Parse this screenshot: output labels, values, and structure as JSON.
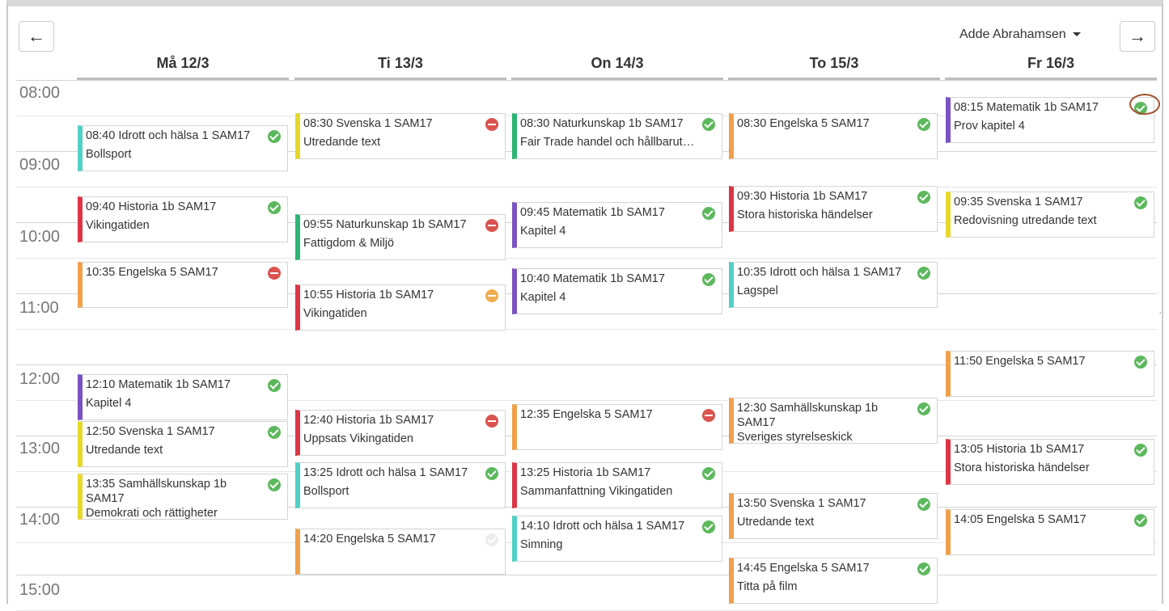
{
  "user": {
    "name": "Adde Abrahamsen"
  },
  "nav": {
    "prev_icon": "arrow-left",
    "next_icon": "arrow-right"
  },
  "days": [
    "Må 12/3",
    "Ti 13/3",
    "On 14/3",
    "To 15/3",
    "Fr 16/3"
  ],
  "times": [
    "08:00",
    "09:00",
    "10:00",
    "11:00",
    "12:00",
    "13:00",
    "14:00",
    "15:00"
  ],
  "colors": {
    "teal": "#4fd1c5",
    "red": "#dc3545",
    "orange": "#f0a04b",
    "purple": "#7b52c1",
    "yellow": "#e6d829",
    "green": "#2bb673",
    "status_ok": "#5cb85c",
    "status_no": "#d9534f",
    "status_warn": "#f0ad4e"
  },
  "events": {
    "mon": [
      {
        "line1": "08:40 Idrott och hälsa 1 SAM17",
        "line2": "Bollsport",
        "status": "ok"
      },
      {
        "line1": "09:40 Historia 1b SAM17",
        "line2": "Vikingatiden",
        "status": "ok"
      },
      {
        "line1": "10:35 Engelska 5 SAM17",
        "line2": "",
        "status": "no"
      },
      {
        "line1": "12:10 Matematik 1b SAM17",
        "line2": "Kapitel 4",
        "status": "ok"
      },
      {
        "line1": "12:50 Svenska 1 SAM17",
        "line2": "Utredande text",
        "status": "ok"
      },
      {
        "line1": "13:35 Samhällskunskap 1b SAM17",
        "line2": "Demokrati och rättigheter",
        "status": "ok"
      }
    ],
    "tue": [
      {
        "line1": "08:30 Svenska 1 SAM17",
        "line2": "Utredande text",
        "status": "no"
      },
      {
        "line1": "09:55 Naturkunskap 1b SAM17",
        "line2": "Fattigdom & Miljö",
        "status": "no"
      },
      {
        "line1": "10:55 Historia 1b SAM17",
        "line2": "Vikingatiden",
        "status": "warn"
      },
      {
        "line1": "12:40 Historia 1b SAM17",
        "line2": "Uppsats Vikingatiden",
        "status": "no"
      },
      {
        "line1": "13:25 Idrott och hälsa 1 SAM17",
        "line2": "Bollsport",
        "status": "ok"
      },
      {
        "line1": "14:20 Engelska 5 SAM17",
        "line2": "",
        "status": "pending"
      }
    ],
    "wed": [
      {
        "line1": "08:30 Naturkunskap 1b SAM17",
        "line2": "Fair Trade handel och hållbarutvec...",
        "status": "ok"
      },
      {
        "line1": "09:45 Matematik 1b SAM17",
        "line2": "Kapitel 4",
        "status": "ok"
      },
      {
        "line1": "10:40 Matematik 1b SAM17",
        "line2": "Kapitel 4",
        "status": "ok"
      },
      {
        "line1": "12:35 Engelska 5 SAM17",
        "line2": "",
        "status": "no"
      },
      {
        "line1": "13:25 Historia 1b SAM17",
        "line2": "Sammanfattning Vikingatiden",
        "status": "ok"
      },
      {
        "line1": "14:10 Idrott och hälsa 1 SAM17",
        "line2": "Simning",
        "status": "ok"
      }
    ],
    "thu": [
      {
        "line1": "08:30 Engelska 5 SAM17",
        "line2": "",
        "status": "ok"
      },
      {
        "line1": "09:30 Historia 1b SAM17",
        "line2": "Stora historiska händelser",
        "status": "ok"
      },
      {
        "line1": "10:35 Idrott och hälsa 1 SAM17",
        "line2": "Lagspel",
        "status": "ok"
      },
      {
        "line1": "12:30 Samhällskunskap 1b SAM17",
        "line2": "Sveriges styrelseskick",
        "status": "ok"
      },
      {
        "line1": "13:50 Svenska 1 SAM17",
        "line2": "Utredande text",
        "status": "ok"
      },
      {
        "line1": "14:45 Engelska 5 SAM17",
        "line2": "Titta på film",
        "status": "ok"
      }
    ],
    "fri": [
      {
        "line1": "08:15 Matematik 1b SAM17",
        "line2": "Prov kapitel 4",
        "status": "ok"
      },
      {
        "line1": "09:35 Svenska 1 SAM17",
        "line2": "Redovisning utredande text",
        "status": "ok"
      },
      {
        "line1": "11:50 Engelska 5 SAM17",
        "line2": "",
        "status": "ok"
      },
      {
        "line1": "13:05 Historia 1b SAM17",
        "line2": "Stora historiska händelser",
        "status": "ok"
      },
      {
        "line1": "14:05 Engelska 5 SAM17",
        "line2": "",
        "status": "ok"
      }
    ]
  }
}
